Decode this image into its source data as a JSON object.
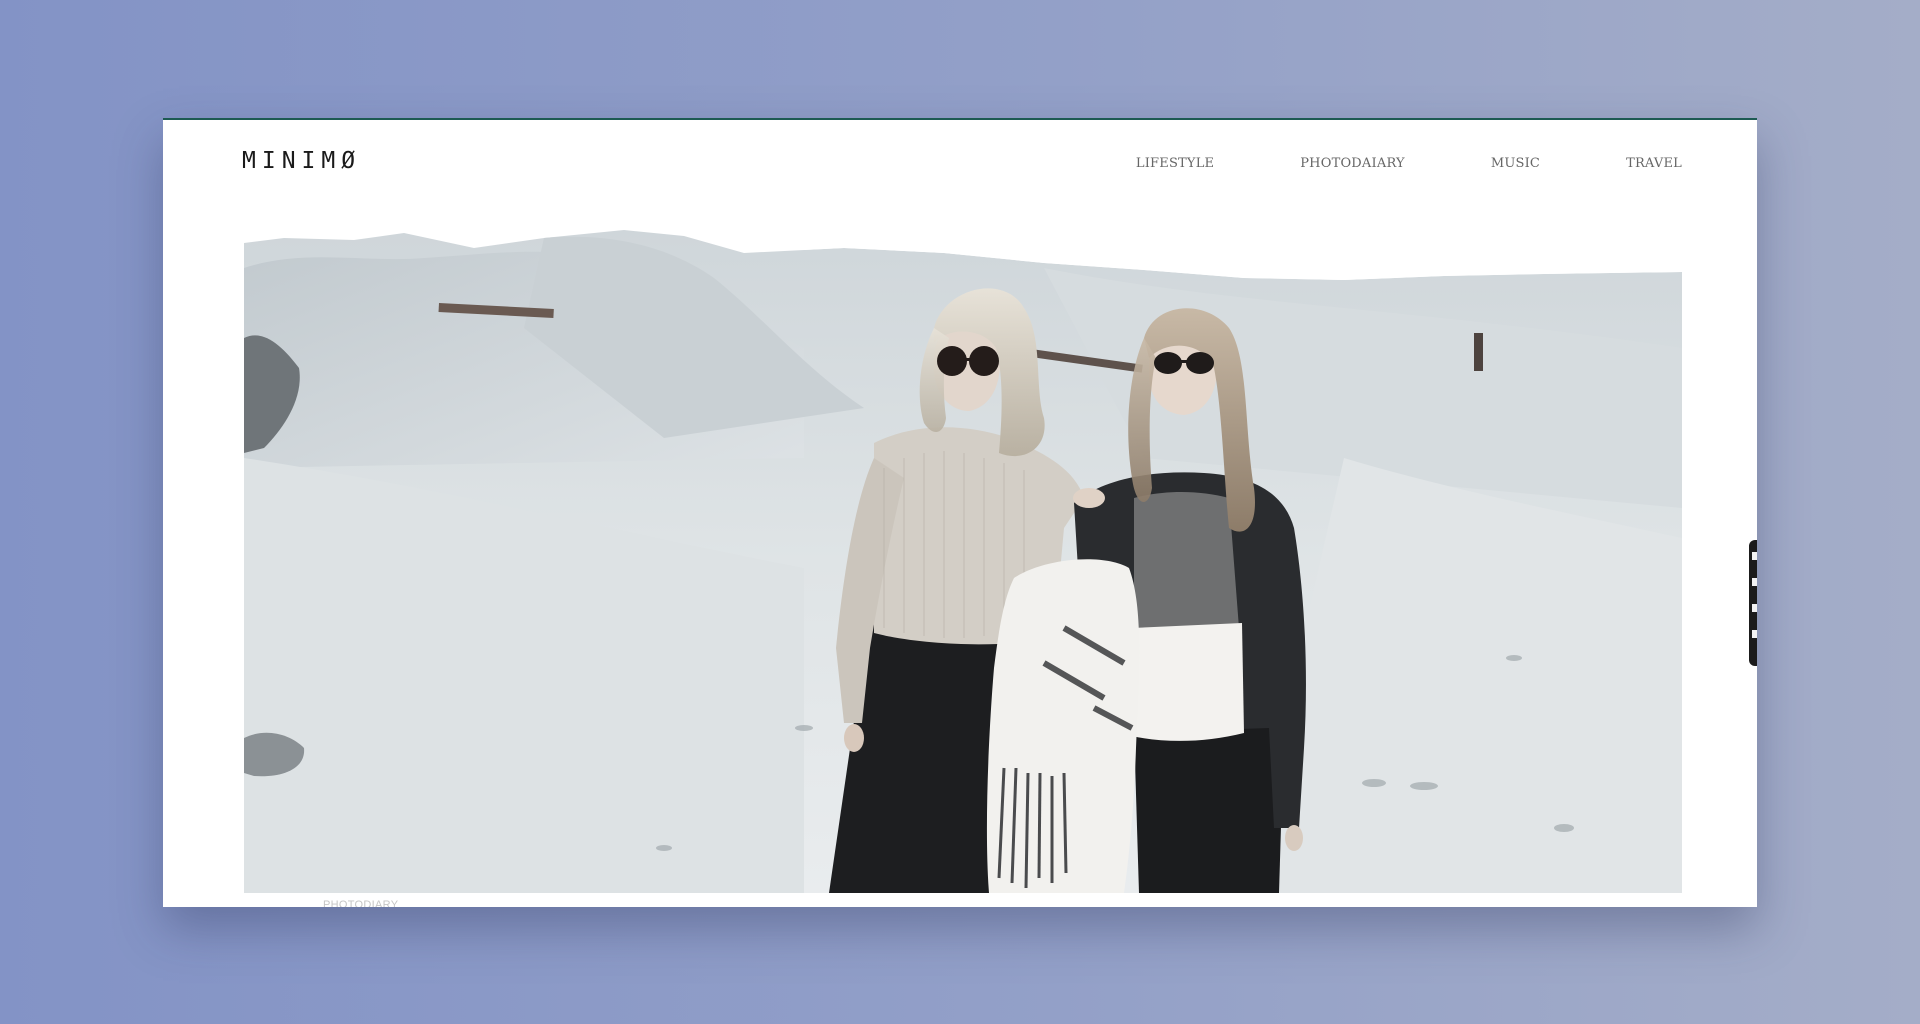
{
  "site": {
    "logo": "MINIMØ"
  },
  "nav": {
    "items": [
      {
        "label": "LIFESTYLE"
      },
      {
        "label": "PHOTODAIARY"
      },
      {
        "label": "MUSIC"
      },
      {
        "label": "TRAVEL"
      }
    ]
  },
  "hero": {
    "caption": "PHOTODIARY"
  },
  "colors": {
    "accent_border": "#1d5a52",
    "background_left": "#8393c6",
    "background_right": "#a4adc8"
  }
}
